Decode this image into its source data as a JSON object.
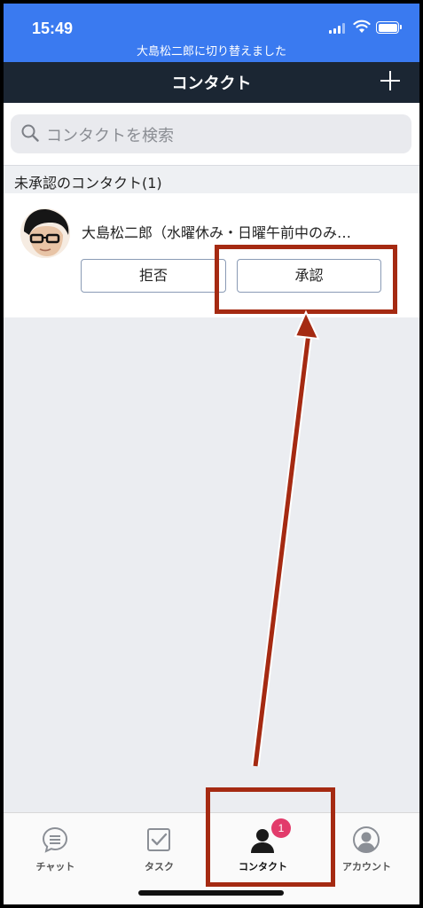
{
  "status_bar": {
    "time": "15:49",
    "notice": "大島松二郎に切り替えました"
  },
  "nav": {
    "title": "コンタクト"
  },
  "search": {
    "placeholder": "コンタクトを検索"
  },
  "pending": {
    "section_title": "未承認のコンタクト(1)",
    "contact": {
      "name": "大島松二郎（水曜休み・日曜午前中のみ…",
      "reject_label": "拒否",
      "approve_label": "承認"
    }
  },
  "tabs": [
    {
      "label": "チャット",
      "icon": "chat-icon"
    },
    {
      "label": "タスク",
      "icon": "task-checkbox-icon"
    },
    {
      "label": "コンタクト",
      "icon": "contact-person-icon",
      "badge": "1",
      "active": true
    },
    {
      "label": "アカウント",
      "icon": "account-icon"
    }
  ],
  "colors": {
    "status_bar": "#3a7af0",
    "nav_bar": "#1b2633",
    "annotation": "#a52a12",
    "badge": "#e23b6b"
  }
}
